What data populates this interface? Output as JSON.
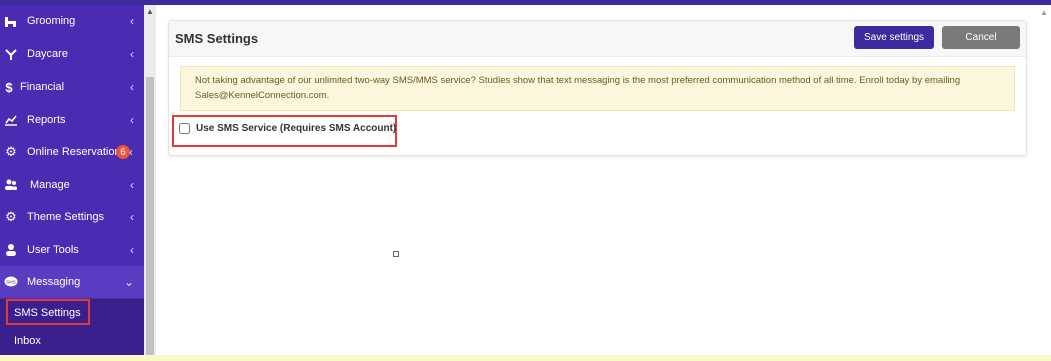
{
  "sidebar": {
    "items": [
      {
        "label": "Grooming",
        "icon": "grooming-icon",
        "glyph": "🛁",
        "chevron": "‹"
      },
      {
        "label": "Daycare",
        "icon": "daycare-icon",
        "glyph": "🐾",
        "chevron": "‹"
      },
      {
        "label": "Financial",
        "icon": "dollar-icon",
        "glyph": "$",
        "chevron": "‹"
      },
      {
        "label": "Reports",
        "icon": "chart-icon",
        "glyph": "📈",
        "chevron": "‹"
      },
      {
        "label": "Online Reservations",
        "icon": "gear-icon",
        "glyph": "⚙",
        "badge": "6",
        "chevron": "‹"
      },
      {
        "label": "Manage",
        "icon": "users-icon",
        "glyph": "👥",
        "chevron": "‹"
      },
      {
        "label": "Theme Settings",
        "icon": "gear-icon",
        "glyph": "⚙",
        "chevron": "‹"
      },
      {
        "label": "User Tools",
        "icon": "user-icon",
        "glyph": "👤",
        "chevron": "‹"
      },
      {
        "label": "Messaging",
        "icon": "sms-icon",
        "glyph": "SMS",
        "chevron": "⌄"
      }
    ],
    "sub_items": [
      {
        "label": "SMS Settings"
      },
      {
        "label": "Inbox"
      }
    ]
  },
  "card": {
    "title": "SMS Settings",
    "save_label": "Save settings",
    "cancel_label": "Cancel",
    "alert_text": "Not taking advantage of our unlimited two-way SMS/MMS service? Studies show that text messaging is the most preferred communication method of all time. Enroll today by emailing Sales@KennelConnection.com.",
    "option_label": "Use SMS Service (Requires SMS Account)",
    "option_checked": false
  },
  "colors": {
    "sidebar": "#4b2bb2",
    "primary_button": "#3e2a9e",
    "highlight": "#e53935"
  }
}
